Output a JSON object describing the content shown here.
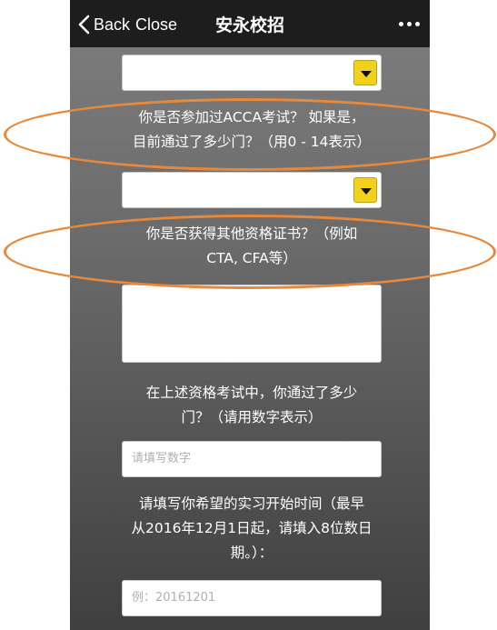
{
  "navbar": {
    "back_label": "Back",
    "close_label": "Close",
    "title": "安永校招"
  },
  "form": {
    "acca_question": "你是否参加过ACCA考试？ 如果是，\n目前通过了多少门？（用0 - 14表示）",
    "other_cert_question": "你是否获得其他资格证书？（例如\nCTA, CFA等）",
    "passed_count_question": "在上述资格考试中，你通过了多少\n门？（请用数字表示）",
    "passed_count_placeholder": "请填写数字",
    "internship_date_question": "请填写你希望的实习开始时间（最早\n从2016年12月1日起，请填入8位数日\n期。）：",
    "internship_date_placeholder": "例：20161201"
  },
  "annotation": {
    "highlight_color": "#e8883a"
  }
}
